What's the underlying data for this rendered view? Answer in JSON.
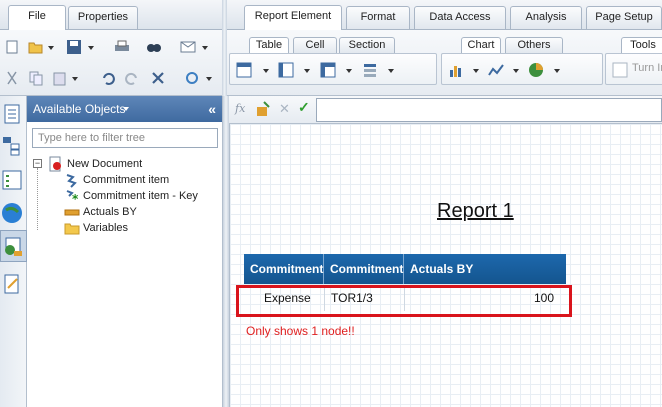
{
  "left_tabs": [
    {
      "label": "File"
    },
    {
      "label": "Properties"
    }
  ],
  "top_tabs": [
    {
      "label": "Report Element"
    },
    {
      "label": "Format"
    },
    {
      "label": "Data Access"
    },
    {
      "label": "Analysis"
    },
    {
      "label": "Page Setup"
    }
  ],
  "sub_tabs": [
    {
      "label": "Table"
    },
    {
      "label": "Cell"
    },
    {
      "label": "Section"
    },
    {
      "label": "Chart"
    },
    {
      "label": "Others"
    },
    {
      "label": "Tools"
    }
  ],
  "turn_into_label": "Turn In",
  "panel": {
    "title": "Available Objects",
    "filter_placeholder": "Type here to filter tree"
  },
  "tree": [
    {
      "label": "New Document"
    },
    {
      "label": "Commitment item"
    },
    {
      "label": "Commitment item - Key"
    },
    {
      "label": "Actuals BY"
    },
    {
      "label": "Variables"
    }
  ],
  "report": {
    "title": "Report 1",
    "headers": [
      "Commitment",
      "Commitment",
      "Actuals BY"
    ],
    "row": [
      "Expense",
      "TOR1/3",
      "100"
    ],
    "note": "Only shows 1 node!!"
  },
  "colors": {
    "header_blue": "#14558f",
    "highlight_red": "#d9141c",
    "note_red": "#e02020"
  }
}
